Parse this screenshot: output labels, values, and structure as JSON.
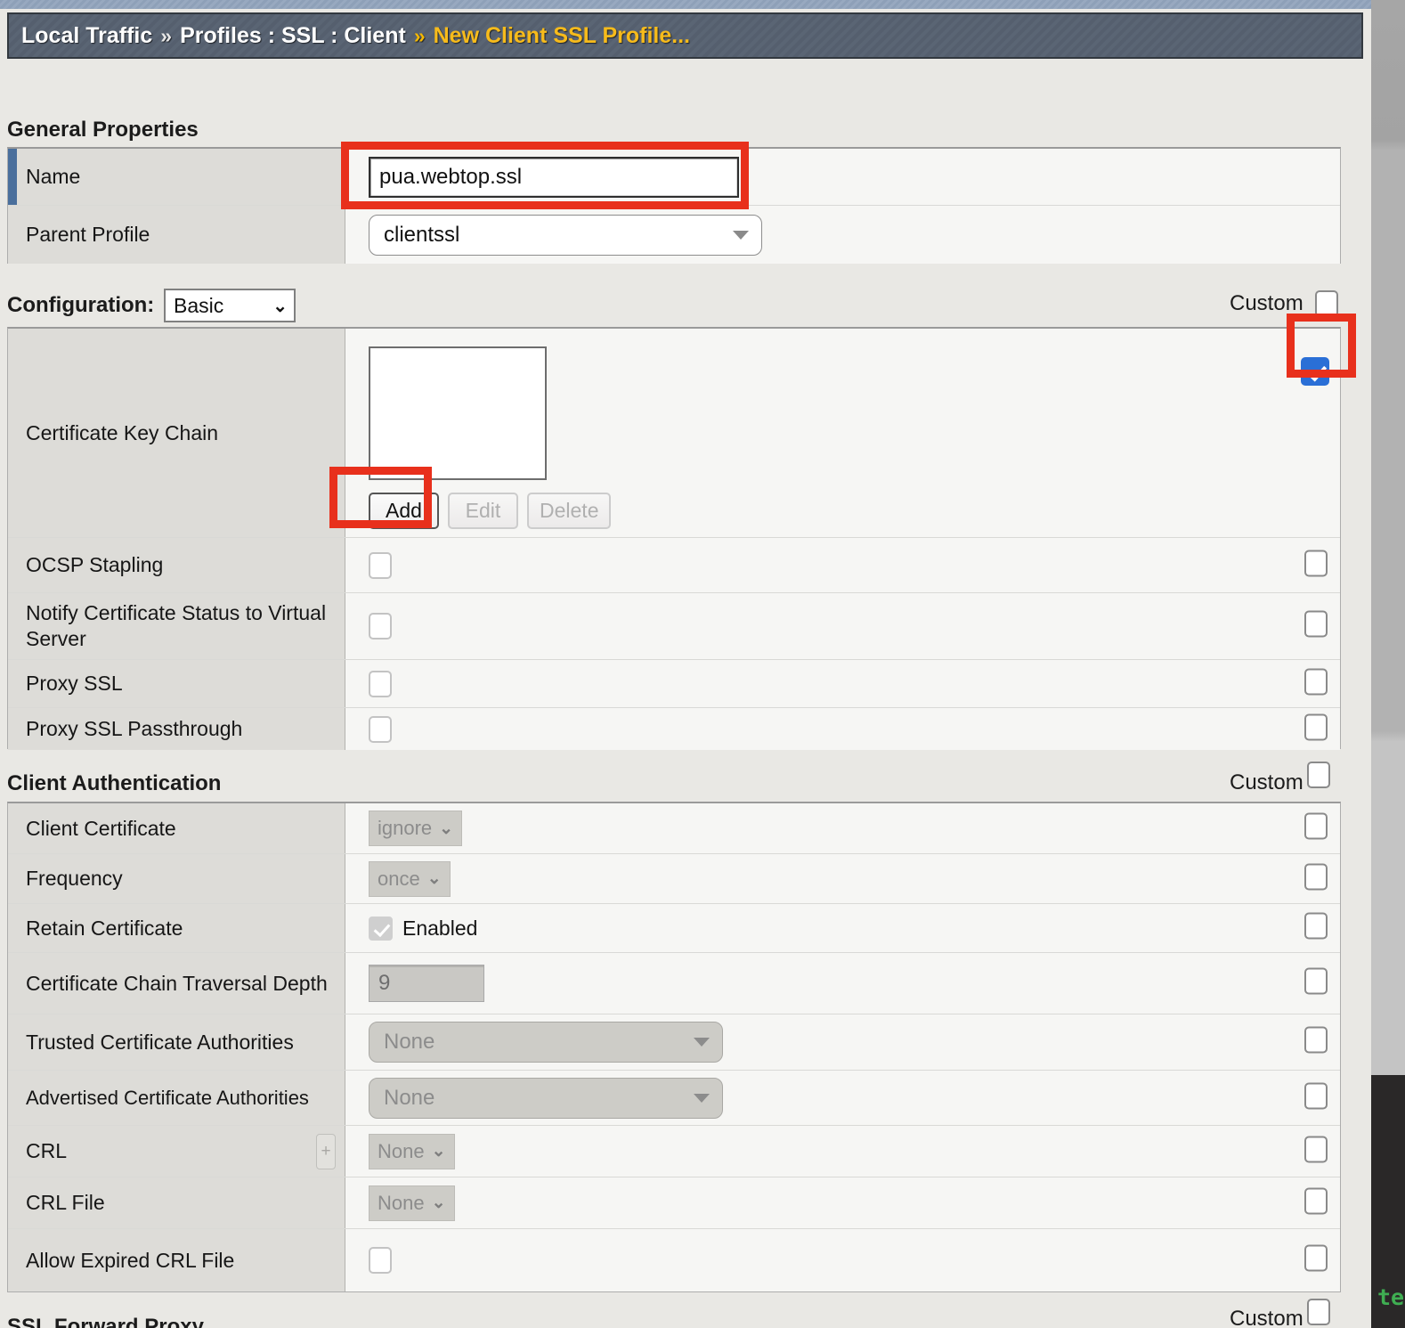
{
  "breadcrumb": {
    "items": [
      {
        "label": "Local Traffic",
        "gold": false
      },
      {
        "label": "Profiles : SSL : Client",
        "gold": false
      },
      {
        "label": "New Client SSL Profile...",
        "gold": true
      }
    ],
    "separator": "»"
  },
  "general_properties": {
    "heading": "General Properties",
    "name": {
      "label": "Name",
      "value": "pua.webtop.ssl",
      "placeholder": ""
    },
    "parent_profile": {
      "label": "Parent Profile",
      "value": "clientssl"
    }
  },
  "configuration": {
    "label": "Configuration:",
    "value": "Basic",
    "custom_label": "Custom",
    "custom_checked": false,
    "rows": [
      {
        "label": "Certificate Key Chain",
        "type": "listbox",
        "list_items": [],
        "buttons": [
          {
            "label": "Add",
            "enabled": true
          },
          {
            "label": "Edit",
            "enabled": false
          },
          {
            "label": "Delete",
            "enabled": false
          }
        ],
        "custom_checked": true
      },
      {
        "label": "OCSP Stapling",
        "type": "checkbox",
        "checked": false,
        "custom_checked": false
      },
      {
        "label": "Notify Certificate Status to Virtual Server",
        "type": "checkbox",
        "checked": false,
        "custom_checked": false
      },
      {
        "label": "Proxy SSL",
        "type": "checkbox",
        "checked": false,
        "custom_checked": false
      },
      {
        "label": "Proxy SSL Passthrough",
        "type": "checkbox",
        "checked": false,
        "custom_checked": false
      }
    ]
  },
  "client_authentication": {
    "heading": "Client Authentication",
    "custom_label": "Custom",
    "custom_checked": false,
    "rows": [
      {
        "label": "Client Certificate",
        "type": "minisel",
        "value": "ignore",
        "enabled": false,
        "custom_checked": false
      },
      {
        "label": "Frequency",
        "type": "minisel",
        "value": "once",
        "enabled": false,
        "custom_checked": false
      },
      {
        "label": "Retain Certificate",
        "type": "checkbox-label",
        "value": "Enabled",
        "checked": true,
        "enabled": false,
        "custom_checked": false
      },
      {
        "label": "Certificate Chain Traversal Depth",
        "type": "textinput",
        "value": "9",
        "enabled": false,
        "custom_checked": false
      },
      {
        "label": "Trusted Certificate Authorities",
        "type": "select",
        "value": "None",
        "enabled": false,
        "custom_checked": false
      },
      {
        "label": "Advertised Certificate Authorities",
        "type": "select",
        "value": "None",
        "enabled": false,
        "custom_checked": false
      },
      {
        "label": "CRL",
        "type": "minisel",
        "value": "None",
        "enabled": false,
        "expander": "+",
        "custom_checked": false
      },
      {
        "label": "CRL File",
        "type": "minisel",
        "value": "None",
        "enabled": false,
        "custom_checked": false
      },
      {
        "label": "Allow Expired CRL File",
        "type": "checkbox",
        "checked": false,
        "custom_checked": false
      }
    ]
  },
  "next_section": {
    "heading": "SSL Forward Proxy",
    "custom_label": "Custom"
  },
  "background": {
    "terminal_text": "te"
  },
  "colors": {
    "annotation": "#e8301c",
    "accent_blue": "#2a6fd6",
    "required_bar": "#4a6f9c",
    "crumb_gold": "#f7bb1b"
  }
}
